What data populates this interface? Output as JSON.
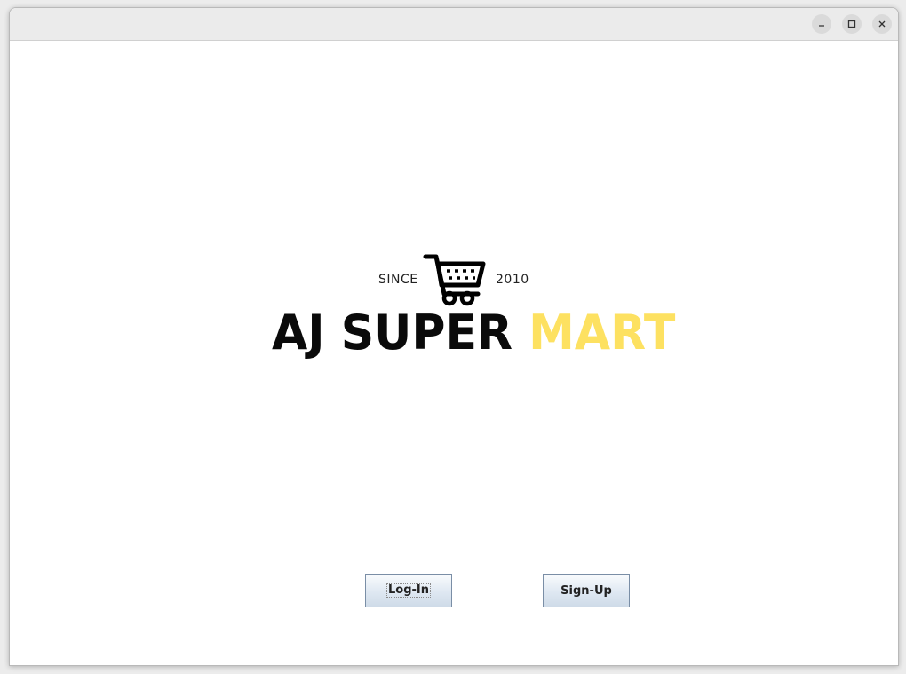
{
  "window": {
    "controls": {
      "minimize_icon": "minimize-icon",
      "maximize_icon": "maximize-icon",
      "close_icon": "close-icon"
    }
  },
  "logo": {
    "since": "SINCE",
    "year": "2010",
    "brand_dark": "AJ SUPER",
    "brand_accent": "MART",
    "accent_color": "#fde161",
    "icon": "shopping-cart-icon"
  },
  "buttons": {
    "login_label": "Log-In",
    "signup_label": "Sign-Up"
  }
}
